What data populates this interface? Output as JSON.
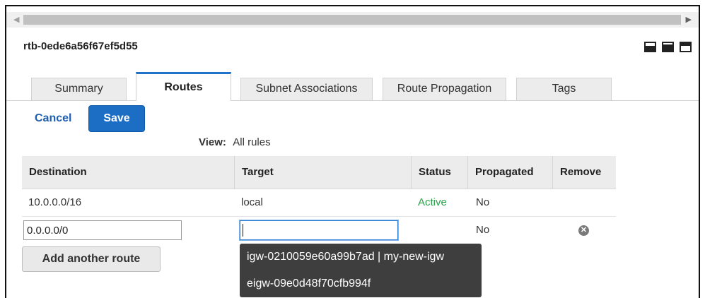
{
  "route_table": {
    "id": "rtb-0ede6a56f67ef5d55"
  },
  "scrollbar": {
    "left_arrow": "◀",
    "right_arrow": "▶"
  },
  "layout_icons": [
    "panel-bottom-icon",
    "panel-split-icon",
    "panel-top-icon"
  ],
  "tabs": [
    {
      "label": "Summary",
      "active": false
    },
    {
      "label": "Routes",
      "active": true
    },
    {
      "label": "Subnet Associations",
      "active": false
    },
    {
      "label": "Route Propagation",
      "active": false
    },
    {
      "label": "Tags",
      "active": false
    }
  ],
  "actions": {
    "cancel_label": "Cancel",
    "save_label": "Save"
  },
  "view": {
    "label": "View:",
    "value": "All rules"
  },
  "table": {
    "columns": [
      "Destination",
      "Target",
      "Status",
      "Propagated",
      "Remove"
    ],
    "rows": [
      {
        "destination": "10.0.0.0/16",
        "target": "local",
        "status": "Active",
        "propagated": "No"
      }
    ],
    "edit_row": {
      "destination_value": "0.0.0.0/0",
      "target_value": "",
      "propagated": "No",
      "remove_icon": "remove-circle-icon"
    }
  },
  "add_route_label": "Add another route",
  "suggestions": [
    "igw-0210059e60a99b7ad | my-new-igw",
    "eigw-09e0d48f70cfb994f"
  ],
  "colors": {
    "accent": "#1c6ec4",
    "status_active": "#2aa04a",
    "tooltip_bg": "#3e3e3e"
  }
}
